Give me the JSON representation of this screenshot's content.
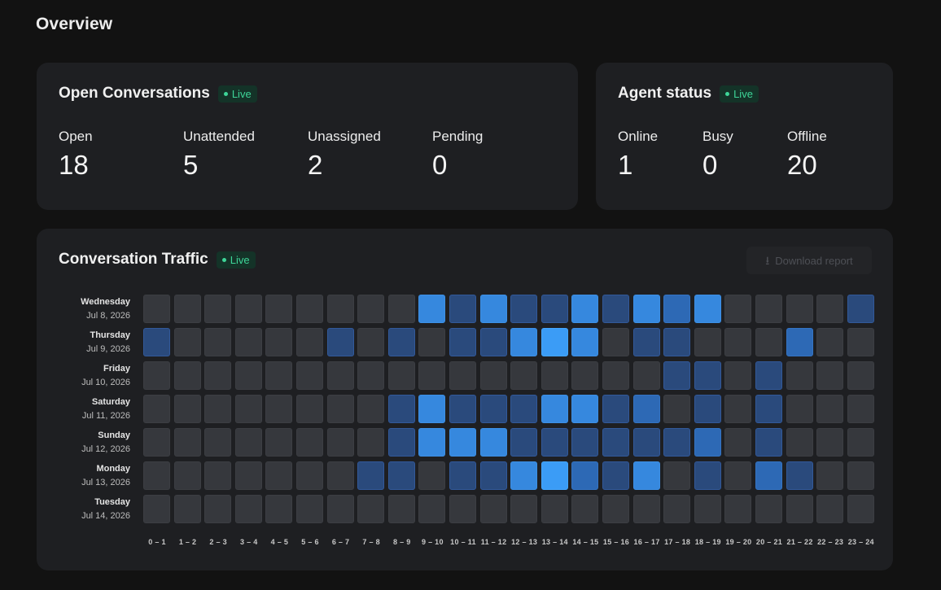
{
  "page": {
    "title": "Overview"
  },
  "open_conversations": {
    "title": "Open Conversations",
    "badge": "Live",
    "metrics": [
      {
        "label": "Open",
        "value": "18"
      },
      {
        "label": "Unattended",
        "value": "5"
      },
      {
        "label": "Unassigned",
        "value": "2"
      },
      {
        "label": "Pending",
        "value": "0"
      }
    ]
  },
  "agent_status": {
    "title": "Agent status",
    "badge": "Live",
    "metrics": [
      {
        "label": "Online",
        "value": "1"
      },
      {
        "label": "Busy",
        "value": "0"
      },
      {
        "label": "Offline",
        "value": "20"
      }
    ]
  },
  "traffic": {
    "title": "Conversation Traffic",
    "badge": "Live",
    "download_label": "Download report",
    "hours": [
      "0 – 1",
      "1 – 2",
      "2 – 3",
      "3 – 4",
      "4 – 5",
      "5 – 6",
      "6 – 7",
      "7 – 8",
      "8 – 9",
      "9 – 10",
      "10 – 11",
      "11 – 12",
      "12 – 13",
      "13 – 14",
      "14 – 15",
      "15 – 16",
      "16 – 17",
      "17 – 18",
      "18 – 19",
      "19 – 20",
      "20 – 21",
      "21 – 22",
      "22 – 23",
      "23 – 24"
    ],
    "days": [
      {
        "day": "Wednesday",
        "date": "Jul 8, 2026",
        "levels": [
          0,
          0,
          0,
          0,
          0,
          0,
          0,
          0,
          0,
          3,
          1,
          3,
          1,
          1,
          3,
          1,
          3,
          2,
          3,
          0,
          0,
          0,
          0,
          1
        ]
      },
      {
        "day": "Thursday",
        "date": "Jul 9, 2026",
        "levels": [
          1,
          0,
          0,
          0,
          0,
          0,
          1,
          0,
          1,
          0,
          1,
          1,
          3,
          4,
          3,
          0,
          1,
          1,
          0,
          0,
          0,
          2,
          0,
          0
        ]
      },
      {
        "day": "Friday",
        "date": "Jul 10, 2026",
        "levels": [
          0,
          0,
          0,
          0,
          0,
          0,
          0,
          0,
          0,
          0,
          0,
          0,
          0,
          0,
          0,
          0,
          0,
          1,
          1,
          0,
          1,
          0,
          0,
          0
        ]
      },
      {
        "day": "Saturday",
        "date": "Jul 11, 2026",
        "levels": [
          0,
          0,
          0,
          0,
          0,
          0,
          0,
          0,
          1,
          3,
          1,
          1,
          1,
          3,
          3,
          1,
          2,
          0,
          1,
          0,
          1,
          0,
          0,
          0
        ]
      },
      {
        "day": "Sunday",
        "date": "Jul 12, 2026",
        "levels": [
          0,
          0,
          0,
          0,
          0,
          0,
          0,
          0,
          1,
          3,
          3,
          3,
          1,
          1,
          1,
          1,
          1,
          1,
          2,
          0,
          1,
          0,
          0,
          0
        ]
      },
      {
        "day": "Monday",
        "date": "Jul 13, 2026",
        "levels": [
          0,
          0,
          0,
          0,
          0,
          0,
          0,
          1,
          1,
          0,
          1,
          1,
          3,
          4,
          2,
          1,
          3,
          0,
          1,
          0,
          2,
          1,
          0,
          0
        ]
      },
      {
        "day": "Tuesday",
        "date": "Jul 14, 2026",
        "levels": [
          0,
          0,
          0,
          0,
          0,
          0,
          0,
          0,
          0,
          0,
          0,
          0,
          0,
          0,
          0,
          0,
          0,
          0,
          0,
          0,
          0,
          0,
          0,
          0
        ]
      }
    ]
  }
}
